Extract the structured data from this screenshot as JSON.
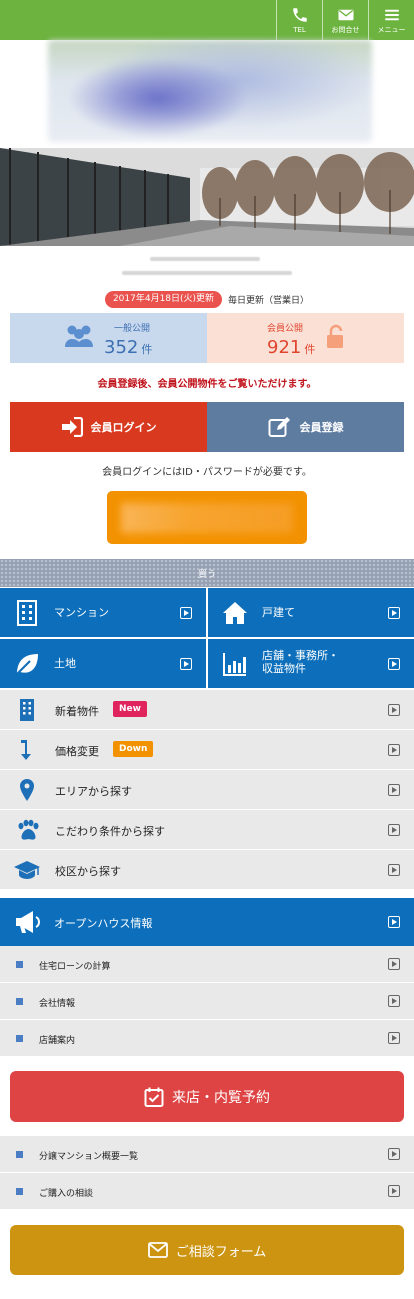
{
  "header": {
    "tel_label": "TEL",
    "contact_label": "お問合せ",
    "menu_label": "メニュー",
    "color": "#6db33f"
  },
  "update": {
    "date_badge": "2017年4月18日(火)更新",
    "schedule": "毎日更新（営業日）"
  },
  "counts": {
    "public_label": "一般公開",
    "public_value": "352",
    "public_unit": "件",
    "member_label": "会員公開",
    "member_value": "921",
    "member_unit": "件"
  },
  "member_note": "会員登録後、会員公開物件をご覧いただけます。",
  "auth": {
    "login_label": "会員ログイン",
    "register_label": "会員登録"
  },
  "login_note": "会員ログインにはID・パスワードが必要です。",
  "buy_section": {
    "title": "買う"
  },
  "categories": [
    {
      "label": "マンション",
      "icon": "building-icon"
    },
    {
      "label": "戸建て",
      "icon": "house-icon"
    },
    {
      "label": "土地",
      "icon": "leaf-icon"
    },
    {
      "label_line1": "店舗・事務所・",
      "label_line2": "収益物件",
      "icon": "bar-chart-icon"
    }
  ],
  "search_items": [
    {
      "label": "新着物件",
      "badge": "New",
      "badge_color": "#e0245e",
      "icon": "building-icon"
    },
    {
      "label": "価格変更",
      "badge": "Down",
      "badge_color": "#f39200",
      "icon": "arrow-down-icon"
    },
    {
      "label": "エリアから探す",
      "icon": "map-pin-icon"
    },
    {
      "label": "こだわり条件から探す",
      "icon": "paw-icon"
    },
    {
      "label": "校区から探す",
      "icon": "graduation-cap-icon"
    }
  ],
  "openhouse": {
    "label": "オープンハウス情報",
    "icon": "megaphone-icon"
  },
  "sub_links_1": [
    {
      "label": "住宅ローンの計算"
    },
    {
      "label": "会社情報"
    },
    {
      "label": "店舗案内"
    }
  ],
  "reserve_button": {
    "label": "来店・内覧予約",
    "color": "#de4444"
  },
  "sub_links_2": [
    {
      "label": "分譲マンション概要一覧"
    },
    {
      "label": "ご購入の相談"
    }
  ],
  "consult_button": {
    "label": "ご相談フォーム",
    "color": "#cc9410"
  }
}
